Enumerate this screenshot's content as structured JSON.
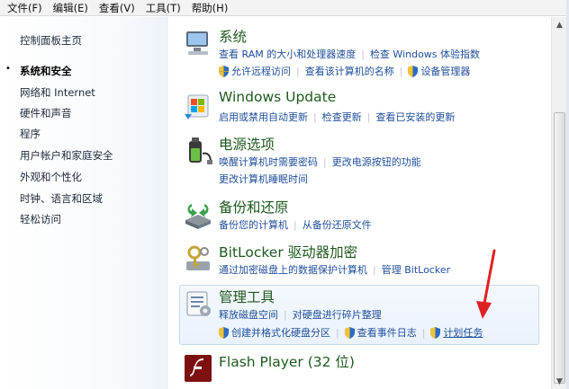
{
  "menu": [
    "文件(F)",
    "编辑(E)",
    "查看(V)",
    "工具(T)",
    "帮助(H)"
  ],
  "sidebar": {
    "home": "控制面板主页",
    "items": [
      {
        "label": "系统和安全",
        "active": true
      },
      {
        "label": "网络和 Internet"
      },
      {
        "label": "硬件和声音"
      },
      {
        "label": "程序"
      },
      {
        "label": "用户帐户和家庭安全"
      },
      {
        "label": "外观和个性化"
      },
      {
        "label": "时钟、语言和区域"
      },
      {
        "label": "轻松访问"
      }
    ]
  },
  "categories": {
    "system": {
      "title": "系统",
      "icon": "computer-icon",
      "links": [
        "查看 RAM 的大小和处理器速度",
        "检查 Windows 体验指数",
        "允许远程访问",
        "查看该计算机的名称",
        "设备管理器"
      ]
    },
    "windows_update": {
      "title": "Windows Update",
      "icon": "windows-update-icon",
      "links": [
        "启用或禁用自动更新",
        "检查更新",
        "查看已安装的更新"
      ]
    },
    "power": {
      "title": "电源选项",
      "icon": "battery-plug-icon",
      "links": [
        "唤醒计算机时需要密码",
        "更改电源按钮的功能",
        "更改计算机睡眠时间"
      ]
    },
    "backup": {
      "title": "备份和还原",
      "icon": "backup-icon",
      "links": [
        "备份您的计算机",
        "从备份还原文件"
      ]
    },
    "bitlocker": {
      "title": "BitLocker 驱动器加密",
      "icon": "bitlocker-keys-icon",
      "links": [
        "通过加密磁盘上的数据保护计算机",
        "管理 BitLocker"
      ]
    },
    "admin_tools": {
      "title": "管理工具",
      "icon": "admin-tools-icon",
      "links": [
        "释放磁盘空间",
        "对硬盘进行碎片整理",
        "创建并格式化硬盘分区",
        "查看事件日志",
        "计划任务"
      ]
    },
    "flash": {
      "title": "Flash Player (32 位)",
      "icon": "flash-player-icon"
    }
  },
  "colors": {
    "title_green": "#1e5a1e",
    "link_blue": "#1f4f9c",
    "annotation_arrow": "#e02020"
  }
}
